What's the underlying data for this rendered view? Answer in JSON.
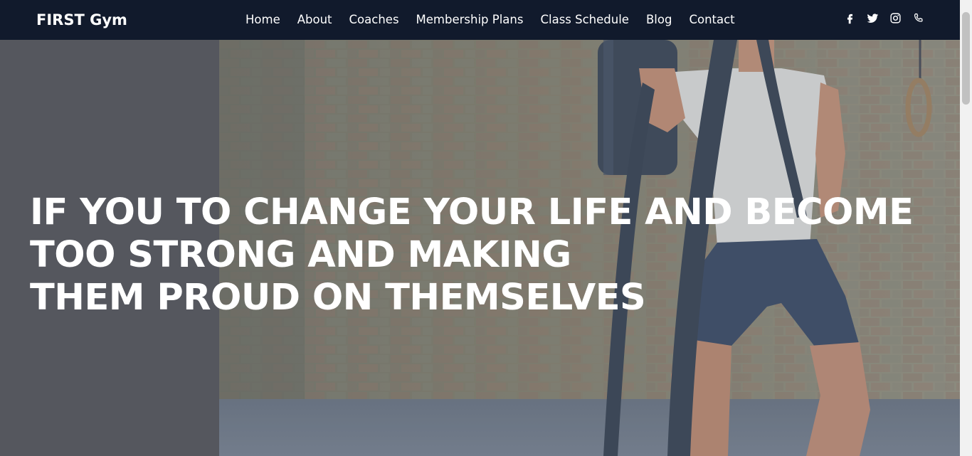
{
  "brand": {
    "name": "FIRST Gym"
  },
  "nav": {
    "links": [
      {
        "label": "Home"
      },
      {
        "label": "About"
      },
      {
        "label": "Coaches"
      },
      {
        "label": "Membership Plans"
      },
      {
        "label": "Class Schedule"
      },
      {
        "label": "Blog"
      },
      {
        "label": "Contact"
      }
    ]
  },
  "social": {
    "icons": [
      "facebook-icon",
      "twitter-icon",
      "instagram-icon",
      "phone-icon"
    ]
  },
  "hero": {
    "headline_lines": [
      "IF YOU TO CHANGE YOUR LIFE AND BECOME",
      "TOO STRONG AND MAKING",
      "THEM PROUD ON THEMSELVES"
    ]
  },
  "colors": {
    "navbar_bg": "#111a2c",
    "hero_left_panel": "#58595f",
    "text": "#ffffff"
  }
}
